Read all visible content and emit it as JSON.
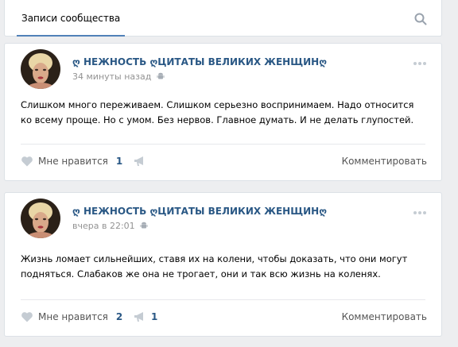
{
  "tabs": {
    "active_label": "Записи сообщества"
  },
  "posts": [
    {
      "author": "ღ НЕЖНОСТЬ ღЦИТАТЫ ВЕЛИКИХ ЖЕНЩИНღ",
      "time": "34 минуты назад",
      "text": "Слишком много переживаем. Слишком серьезно воспринимаем. Надо относится ко всему проще. Но с умом. Без нервов. Главное думать. И не делать глупостей.",
      "like_label": "Мне нравится",
      "like_count": "1",
      "share_count": "",
      "comment_label": "Комментировать"
    },
    {
      "author": "ღ НЕЖНОСТЬ ღЦИТАТЫ ВЕЛИКИХ ЖЕНЩИНღ",
      "time": "вчера в 22:01",
      "text": "Жизнь ломает сильнейших, ставя их на колени, чтобы доказать, что они могут подняться. Слабаков же она не трогает, они и так всю жизнь на коленях.",
      "like_label": "Мне нравится",
      "like_count": "2",
      "share_count": "1",
      "comment_label": "Комментировать"
    }
  ],
  "icons": {
    "search": "search-icon",
    "more": "more-icon",
    "android": "android-icon",
    "heart": "heart-icon",
    "share": "megaphone-icon"
  },
  "colors": {
    "accent": "#5181b8",
    "link": "#2a5885",
    "background": "#edeef0",
    "muted": "#939393"
  }
}
